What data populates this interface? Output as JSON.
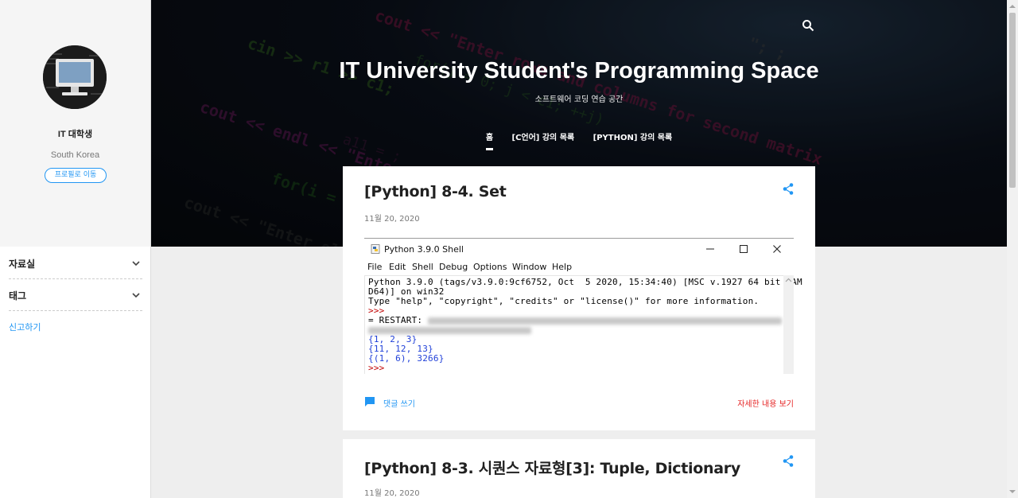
{
  "sidebar": {
    "profile_name": "IT 대학생",
    "profile_location": "South Korea",
    "profile_button": "프로필로 이동",
    "sections": [
      {
        "label": "자료실"
      },
      {
        "label": "태그"
      }
    ],
    "report_link": "신고하기"
  },
  "header": {
    "title": "IT University Student's Programming Space",
    "subtitle": "소프트웨어 코딩 연습 공간",
    "nav": [
      "홈",
      "[C언어] 강의 목록",
      "[PYTHON] 강의 목록"
    ]
  },
  "posts": [
    {
      "title": "[Python] 8-4. Set",
      "date": "11월 20, 2020",
      "comment_label": "댓글 쓰기",
      "more_label": "자세한 내용 보기"
    },
    {
      "title": "[Python] 8-3. 시퀀스 자료형[3]: Tuple, Dictionary",
      "date": "11월 20, 2020"
    }
  ],
  "shell": {
    "window_title": "Python 3.9.0 Shell",
    "menu": [
      "File",
      "Edit",
      "Shell",
      "Debug",
      "Options",
      "Window",
      "Help"
    ],
    "lines": {
      "l1": "Python 3.9.0 (tags/v3.9.0:9cf6752, Oct  5 2020, 15:34:40) [MSC v.1927 64 bit (AM",
      "l2": "D64)] on win32",
      "l3": "Type \"help\", \"copyright\", \"credits\" or \"license()\" for more information.",
      "l4": ">>>",
      "l5": "= RESTART: ",
      "l6": "{1, 2, 3}",
      "l7": "{11, 12, 13}",
      "l8": "{(1, 6), 3266}",
      "l9": ">>>"
    }
  },
  "colors": {
    "accent": "#2196f3",
    "more_link": "#e52222",
    "prompt": "#c00000",
    "shell_output": "#1f3fd8"
  }
}
